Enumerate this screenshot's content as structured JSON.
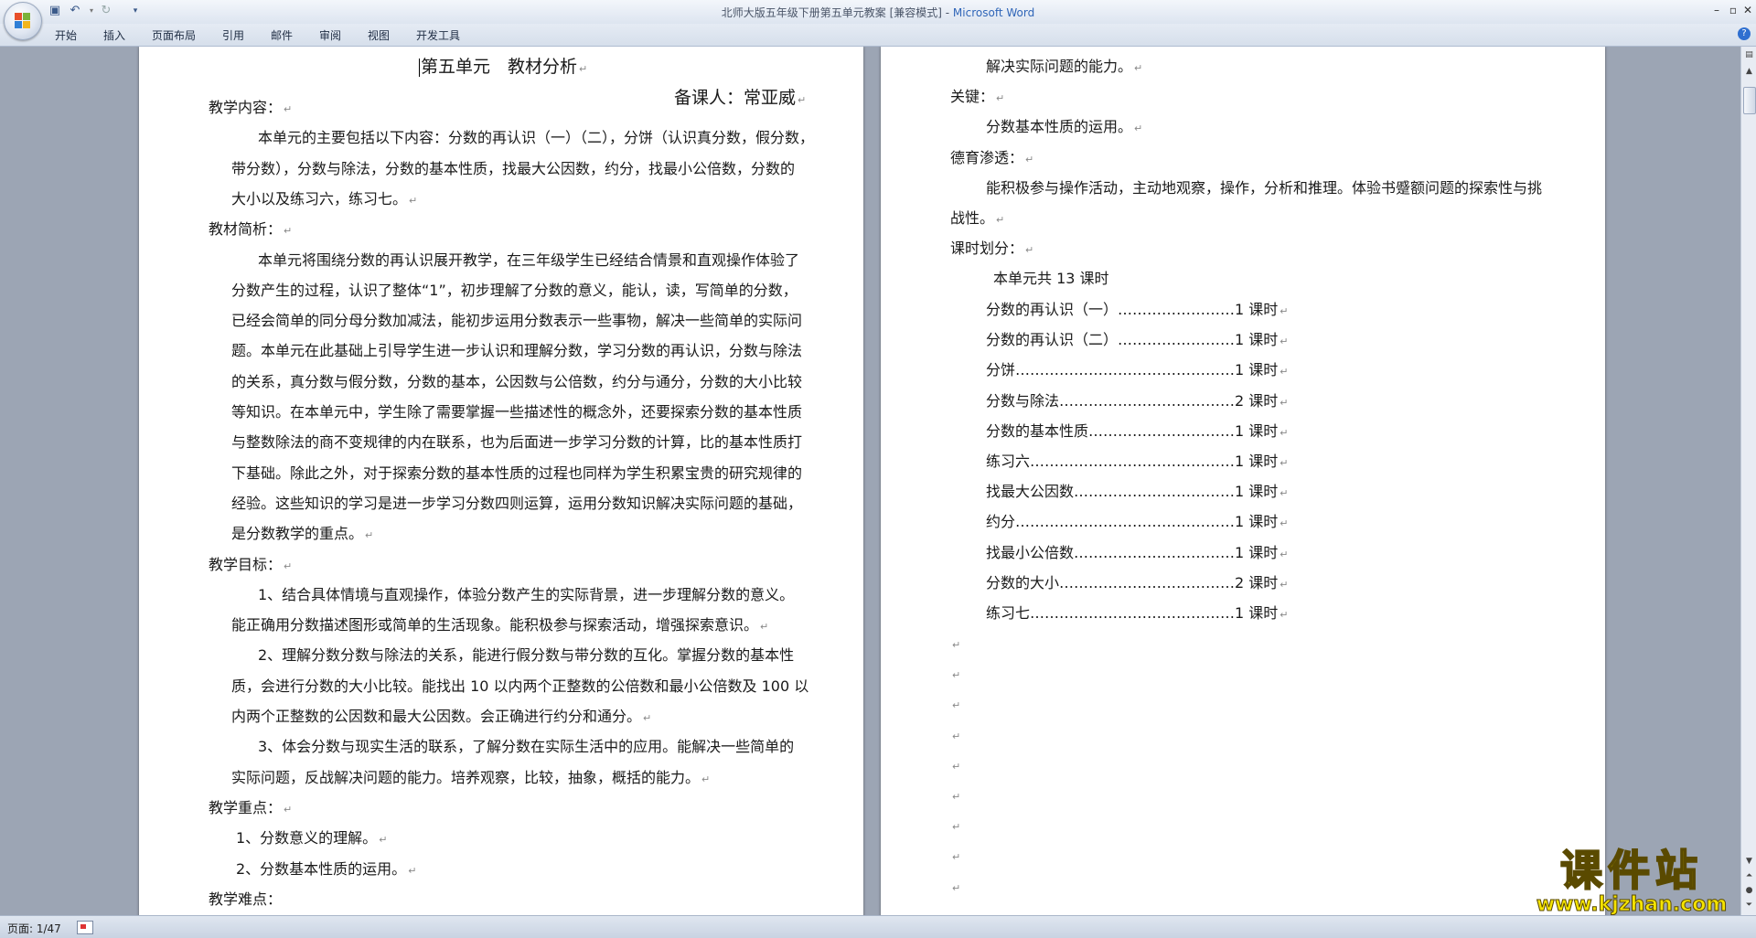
{
  "window": {
    "title_doc": "北师大版五年级下册第五单元教案 [兼容模式] - ",
    "title_app": "Microsoft Word"
  },
  "ribbon": {
    "tabs": [
      "开始",
      "插入",
      "页面布局",
      "引用",
      "邮件",
      "审阅",
      "视图",
      "开发工具"
    ]
  },
  "left_page": {
    "title": "第五单元　教材分析",
    "author": "备课人：常亚威",
    "lines": [
      "教学内容：",
      "本单元的主要包括以下内容：分数的再认识（一）（二），分饼（认识真分数，假分数，",
      "带分数），分数与除法，分数的基本性质，找最大公因数，约分，找最小公倍数，分数的",
      "大小以及练习六，练习七。",
      "教材简析：",
      "本单元将围绕分数的再认识展开教学，在三年级学生已经结合情景和直观操作体验了",
      "分数产生的过程，认识了整体“1”，初步理解了分数的意义，能认，读，写简单的分数，",
      "已经会简单的同分母分数加减法，能初步运用分数表示一些事物，解决一些简单的实际问",
      "题。本单元在此基础上引导学生进一步认识和理解分数，学习分数的再认识，分数与除法",
      "的关系，真分数与假分数，分数的基本，公因数与公倍数，约分与通分，分数的大小比较",
      "等知识。在本单元中，学生除了需要掌握一些描述性的概念外，还要探索分数的基本性质",
      "与整数除法的商不变规律的内在联系，也为后面进一步学习分数的计算，比的基本性质打",
      "下基础。除此之外，对于探索分数的基本性质的过程也同样为学生积累宝贵的研究规律的",
      "经验。这些知识的学习是进一步学习分数四则运算，运用分数知识解决实际问题的基础，",
      "是分数教学的重点。",
      "教学目标：",
      "1、结合具体情境与直观操作，体验分数产生的实际背景，进一步理解分数的意义。",
      "能正确用分数描述图形或简单的生活现象。能积极参与探索活动，增强探索意识。",
      "2、理解分数分数与除法的关系，能进行假分数与带分数的互化。掌握分数的基本性",
      "质，会进行分数的大小比较。能找出 10 以内两个正整数的公倍数和最小公倍数及 100 以",
      "内两个正整数的公因数和最大公因数。会正确进行约分和通分。",
      "3、体会分数与现实生活的联系，了解分数在实际生活中的应用。能解决一些简单的",
      "实际问题，反战解决问题的能力。培养观察，比较，抽象，概括的能力。",
      "教学重点：",
      "1、分数意义的理解。",
      "2、分数基本性质的运用。",
      "教学难点："
    ]
  },
  "right_page": {
    "lines": [
      "解决实际问题的能力。",
      "关键：",
      "分数基本性质的运用。",
      "德育渗透：",
      "能积极参与操作活动，主动地观察，操作，分析和推理。体验书蹙额问题的探索性与挑",
      "战性。",
      "课时划分：",
      "本单元共 13 课时"
    ],
    "schedule": [
      "分数的再认识（一）……………………1 课时",
      "分数的再认识（二）……………………1 课时",
      "分饼………………………………………1 课时",
      "分数与除法………………………………2 课时",
      "分数的基本性质…………………………1 课时",
      "练习六……………………………………1 课时",
      "找最大公因数……………………………1 课时",
      "约分………………………………………1 课时",
      "找最小公倍数……………………………1 课时",
      "分数的大小………………………………2 课时",
      "练习七……………………………………1 课时"
    ]
  },
  "status": {
    "page": "页面: 1/47"
  },
  "watermark": {
    "title": "课件站",
    "url": "www.kjzhan.com"
  }
}
